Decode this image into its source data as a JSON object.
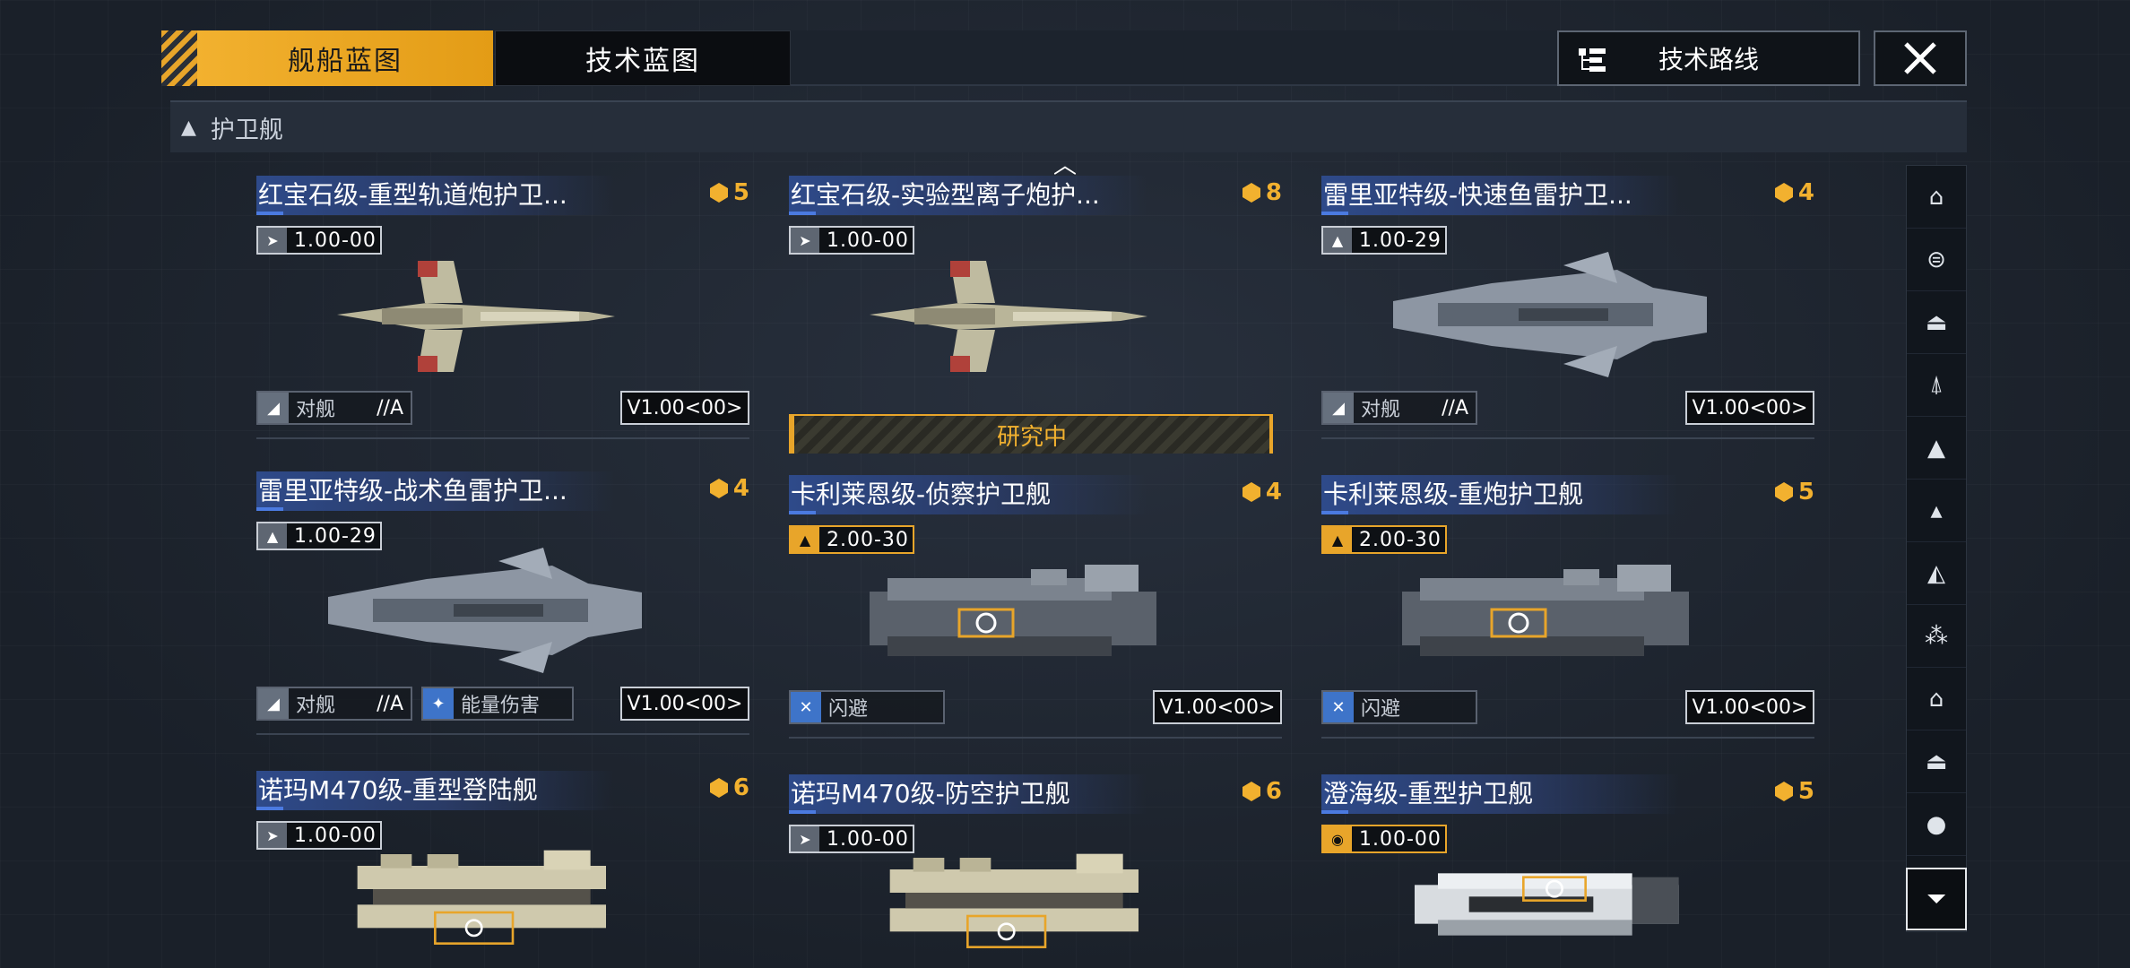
{
  "tabs": {
    "ship_blueprint": "舰船蓝图",
    "tech_blueprint": "技术蓝图"
  },
  "route_button": "技术路线",
  "section": {
    "title": "护卫舰"
  },
  "colors": {
    "accent": "#f2b12f",
    "title_bar": "#2e4a8a",
    "skill_blue": "#3e74c9"
  },
  "cards": [
    {
      "name": "红宝石级-重型轨道炮护卫...",
      "cost": "5",
      "ver": "1.00",
      "ver_sub": "-00",
      "tag1": "对舰",
      "tag1_grade": "//A",
      "version": "V1.00<00>",
      "researching": false,
      "icon": "fighter-icon"
    },
    {
      "name": "红宝石级-实验型离子炮护...",
      "cost": "8",
      "ver": "1.00",
      "ver_sub": "-00",
      "researching": true,
      "research_label": "研究中",
      "icon": "fighter-icon"
    },
    {
      "name": "雷里亚特级-快速鱼雷护卫...",
      "cost": "4",
      "ver": "1.00",
      "ver_sub": "-29",
      "tag1": "对舰",
      "tag1_grade": "//A",
      "version": "V1.00<00>",
      "icon": "rocket-icon"
    },
    {
      "name": "雷里亚特级-战术鱼雷护卫...",
      "cost": "4",
      "ver": "1.00",
      "ver_sub": "-29",
      "tag1": "对舰",
      "tag1_grade": "//A",
      "tag2": "能量伤害",
      "version": "V1.00<00>",
      "icon": "rocket-icon"
    },
    {
      "name": "卡利莱恩级-侦察护卫舰",
      "cost": "4",
      "ver": "2.00",
      "ver_sub": "-30",
      "tag1": "闪避",
      "version": "V1.00<00>",
      "gold": true,
      "icon": "rocket-icon"
    },
    {
      "name": "卡利莱恩级-重炮护卫舰",
      "cost": "5",
      "ver": "2.00",
      "ver_sub": "-30",
      "tag1": "闪避",
      "version": "V1.00<00>",
      "gold": true,
      "icon": "rocket-icon"
    },
    {
      "name": "诺玛M470级-重型登陆舰",
      "cost": "6",
      "ver": "1.00",
      "ver_sub": "-00",
      "icon": "fighter-icon"
    },
    {
      "name": "诺玛M470级-防空护卫舰",
      "cost": "6",
      "ver": "1.00",
      "ver_sub": "-00",
      "icon": "fighter-icon"
    },
    {
      "name": "澄海级-重型护卫舰",
      "cost": "5",
      "ver": "1.00",
      "ver_sub": "-00",
      "gold": true,
      "icon": "shield-icon"
    }
  ],
  "filters": [
    "all-ships-icon",
    "carrier-icon",
    "battlecruiser-icon",
    "cruiser-icon",
    "destroyer-icon",
    "frigate-icon",
    "corvette-icon",
    "fighter-group-icon",
    "support-icon",
    "aux-icon",
    "utility-icon"
  ]
}
